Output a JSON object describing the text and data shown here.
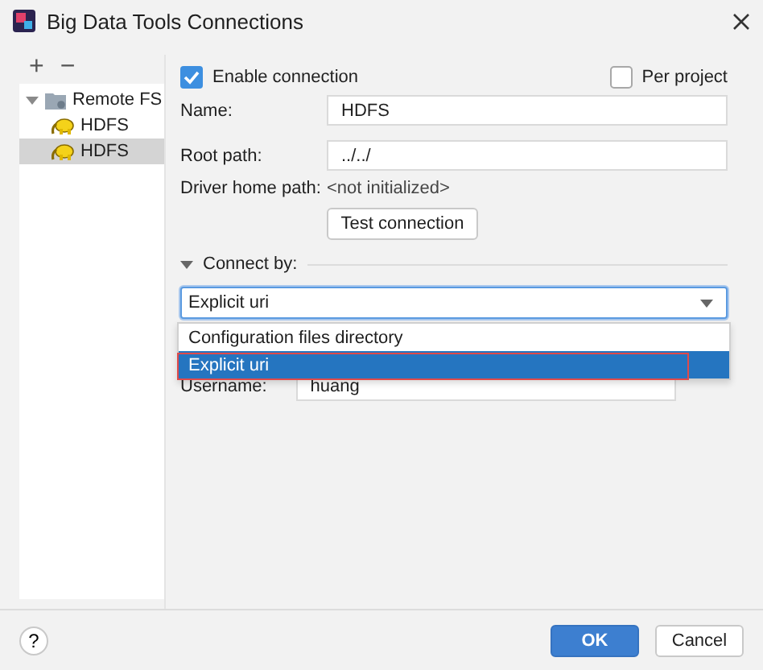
{
  "window": {
    "title": "Big Data Tools Connections"
  },
  "toolbar": [
    "+",
    "−"
  ],
  "tree": [
    {
      "label": "Remote FS",
      "expanded": true,
      "children": [
        {
          "label": "HDFS",
          "selected": false
        },
        {
          "label": "HDFS",
          "selected": true
        }
      ]
    }
  ],
  "enable_connection": {
    "label": "Enable connection",
    "checked": true
  },
  "per_project": {
    "label": "Per project",
    "checked": false
  },
  "fields": [
    {
      "label": "Name:",
      "value": "HDFS"
    },
    {
      "label": "Root path:",
      "value": "../../"
    }
  ],
  "driver_home": {
    "label": "Driver home path:",
    "value": "<not initialized>"
  },
  "test_button": "Test connection",
  "connect_by": {
    "label": "Connect by:",
    "expanded": true,
    "value": "Explicit uri",
    "options": [
      {
        "label": "Configuration files directory",
        "selected": false
      },
      {
        "label": "Explicit uri",
        "selected": true
      }
    ]
  },
  "username": {
    "label": "Username:",
    "value": "huang"
  },
  "help": "?",
  "buttons": [
    {
      "label": "OK",
      "kind": "primary"
    },
    {
      "label": "Cancel",
      "kind": "secondary"
    }
  ]
}
